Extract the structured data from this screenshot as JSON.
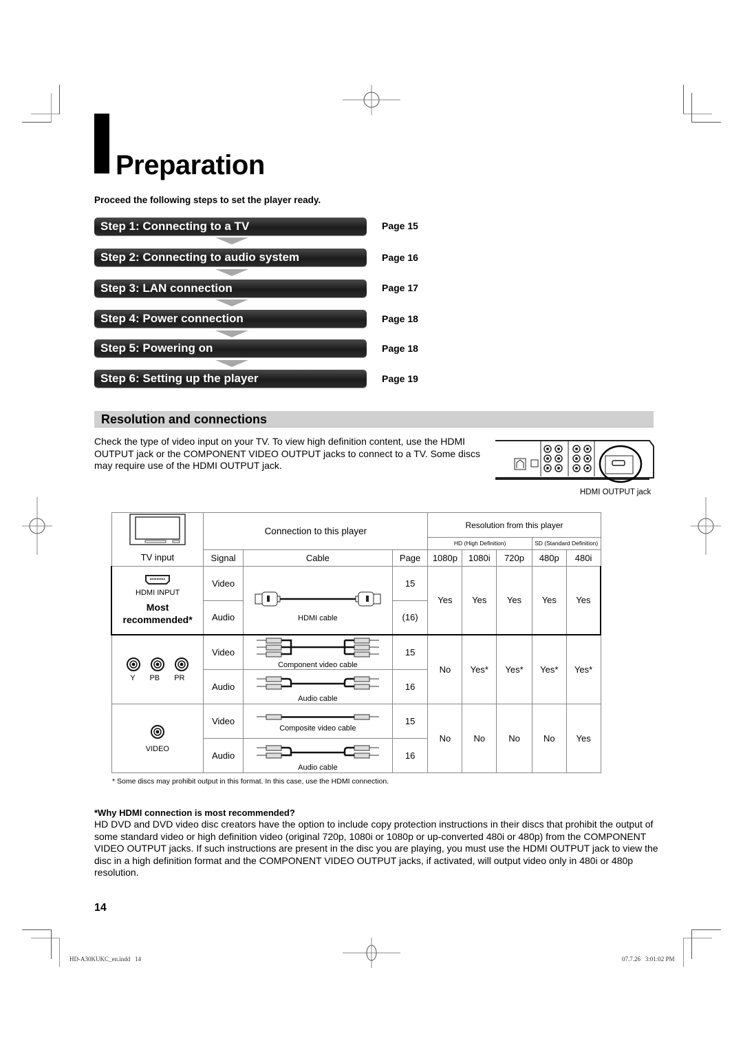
{
  "page": {
    "title": "Preparation",
    "intro": "Proceed the following steps to set the player ready.",
    "steps": [
      {
        "label": "Step 1: Connecting to a TV",
        "page": "Page 15"
      },
      {
        "label": "Step 2: Connecting to audio system",
        "page": "Page 16"
      },
      {
        "label": "Step 3: LAN connection",
        "page": "Page 17"
      },
      {
        "label": "Step 4: Power connection",
        "page": "Page 18"
      },
      {
        "label": "Step 5: Powering on",
        "page": "Page 18"
      },
      {
        "label": "Step 6: Setting up the player",
        "page": "Page 19"
      }
    ],
    "section_title": "Resolution and connections",
    "section_para": "Check the type of video input on your TV. To view high definition content, use the HDMI OUTPUT jack or the COMPONENT VIDEO OUTPUT jacks to connect to a TV. Some discs may require use of the HDMI OUTPUT jack.",
    "jack_caption": "HDMI OUTPUT jack",
    "table": {
      "tv_input": "TV input",
      "connection_header": "Connection to this player",
      "resolution_header": "Resolution from this player",
      "hd_label": "HD (High Definition)",
      "sd_label": "SD (Standard Definition)",
      "col_signal": "Signal",
      "col_cable": "Cable",
      "col_page": "Page",
      "resolutions": [
        "1080p",
        "1080i",
        "720p",
        "480p",
        "480i"
      ],
      "rows": [
        {
          "input_label": "HDMI INPUT",
          "note": "Most recommended*",
          "video_signal": "Video",
          "audio_signal": "Audio",
          "cable_label": "HDMI cable",
          "audio_cable_label": "",
          "video_page": "15",
          "audio_page": "(16)",
          "values": [
            "Yes",
            "Yes",
            "Yes",
            "Yes",
            "Yes"
          ]
        },
        {
          "input_labels": [
            "Y",
            "PB",
            "PR"
          ],
          "video_signal": "Video",
          "audio_signal": "Audio",
          "cable_label": "Component video cable",
          "audio_cable_label": "Audio cable",
          "video_page": "15",
          "audio_page": "16",
          "values": [
            "No",
            "Yes*",
            "Yes*",
            "Yes*",
            "Yes*"
          ]
        },
        {
          "input_label": "VIDEO",
          "video_signal": "Video",
          "audio_signal": "Audio",
          "cable_label": "Composite video cable",
          "audio_cable_label": "Audio cable",
          "video_page": "15",
          "audio_page": "16",
          "values": [
            "No",
            "No",
            "No",
            "No",
            "Yes"
          ]
        }
      ],
      "footnote": "* Some discs may prohibit output in this format. In this case, use the HDMI connection."
    },
    "why_heading": "*Why HDMI connection is most recommended?",
    "why_text": "HD DVD and DVD video disc creators have the option to include copy protection instructions in their discs that prohibit the output of some standard video or high definition video (original 720p, 1080i or 1080p or up-converted 480i or 480p) from the COMPONENT VIDEO OUTPUT jacks. If such instructions are present in the disc you are playing, you must use the HDMI OUTPUT jack to view the disc in a high definition format and the COMPONENT VIDEO OUTPUT jacks, if activated, will output video only in 480i or 480p resolution.",
    "page_number": "14",
    "slug_file": "HD-A30KUKC_en.indd   14",
    "slug_date": "07.7.26   3:01:02 PM"
  }
}
